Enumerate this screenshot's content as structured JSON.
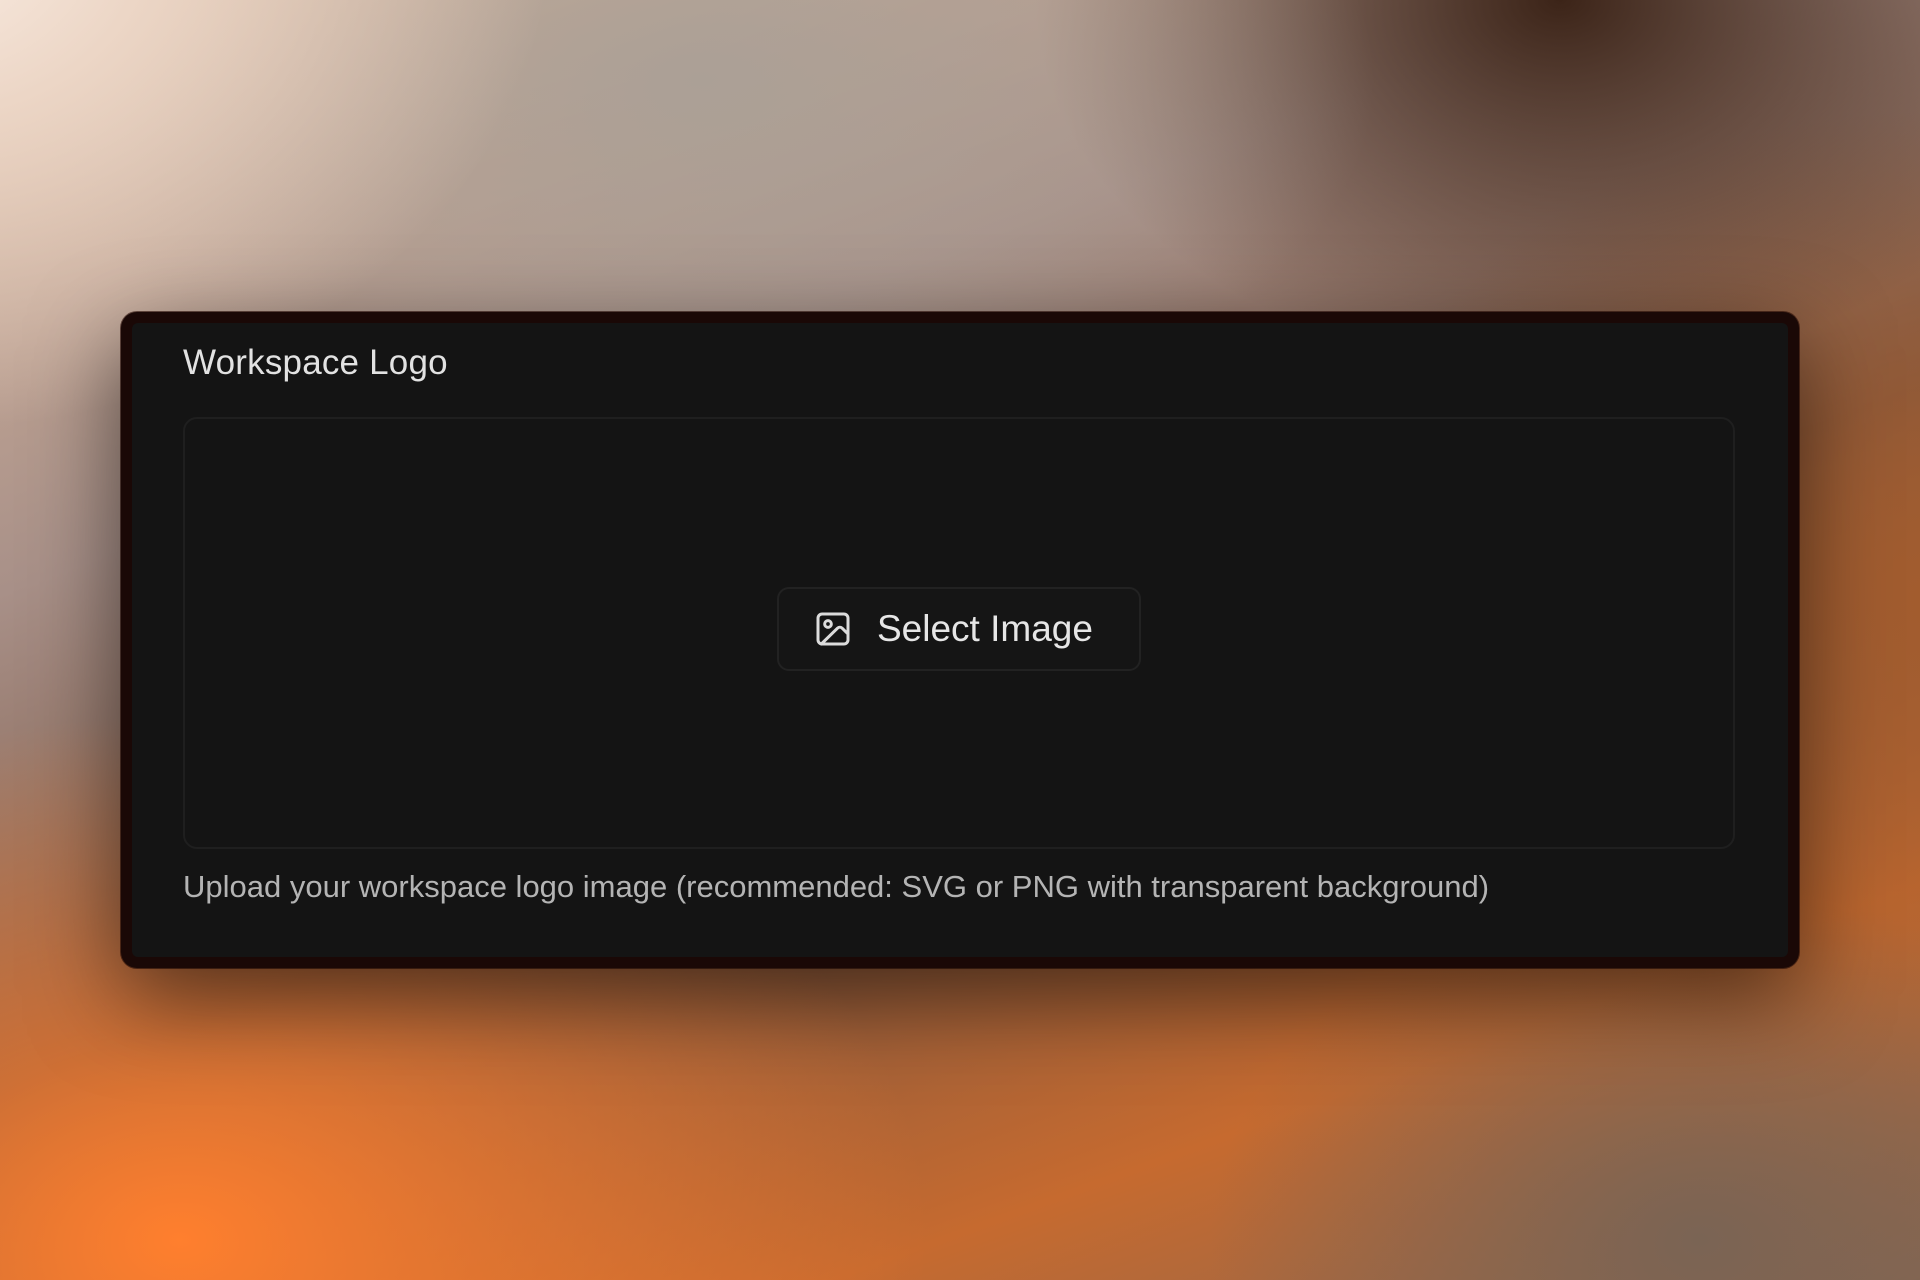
{
  "workspace_logo": {
    "label": "Workspace Logo",
    "select_button_label": "Select Image",
    "select_button_icon": "image-icon",
    "help_text": "Upload your workspace logo image (recommended: SVG or PNG with transparent background)"
  },
  "colors": {
    "panel_background": "#141414",
    "text_primary": "#e2e2e2",
    "text_secondary": "#b4b4b4",
    "border": "#1f1f1f"
  }
}
